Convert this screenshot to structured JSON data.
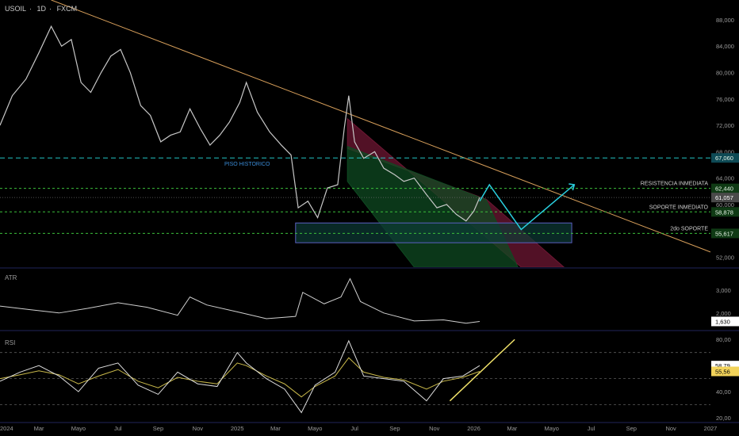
{
  "header": {
    "symbol": "USOIL",
    "timeframe": "1D",
    "exchange": "FXCM"
  },
  "colors": {
    "background": "#000000",
    "price": "#c7c7c7",
    "trendline": "#d9a05b",
    "dashed_level": "#22c3c3",
    "green_level": "#3bbf3b",
    "support_box_fill": "#0d3b36",
    "support_box_border": "#5a5fc0",
    "channel_red": "#6e1733",
    "channel_green": "#0f4a22",
    "projection": "#2ad0e0",
    "rsi_trend": "#f2e36a",
    "rsi_ma": "#c9b94a"
  },
  "chart_data": [
    {
      "type": "line",
      "name": "price",
      "x_ticks": [
        "2024",
        "Mar",
        "Mayo",
        "Jul",
        "Sep",
        "Nov",
        "2025",
        "Mar",
        "Mayo",
        "Jul",
        "Sep",
        "Nov",
        "2026",
        "Mar",
        "Mayo",
        "Jul",
        "Sep",
        "Nov",
        "2027"
      ],
      "x_range": [
        "2024-01",
        "2027-01"
      ],
      "y_ticks": [
        52000,
        56000,
        60000,
        64000,
        68000,
        72000,
        76000,
        80000,
        84000,
        88000
      ],
      "y_tick_labels": [
        "52,000",
        "56,000",
        "60,000",
        "64,000",
        "68,000",
        "72,000",
        "76,000",
        "80,000",
        "84,000",
        "88,000"
      ],
      "ylim": [
        50500,
        91000
      ],
      "grid": false,
      "x": [
        "2024-01-01",
        "2024-01-20",
        "2024-02-10",
        "2024-03-01",
        "2024-03-20",
        "2024-04-05",
        "2024-04-20",
        "2024-05-05",
        "2024-05-20",
        "2024-06-05",
        "2024-06-20",
        "2024-07-05",
        "2024-07-20",
        "2024-08-05",
        "2024-08-20",
        "2024-09-05",
        "2024-09-20",
        "2024-10-05",
        "2024-10-20",
        "2024-11-05",
        "2024-11-20",
        "2024-12-05",
        "2024-12-20",
        "2025-01-05",
        "2025-01-15",
        "2025-02-01",
        "2025-02-20",
        "2025-03-10",
        "2025-03-25",
        "2025-04-05",
        "2025-04-20",
        "2025-05-05",
        "2025-05-20",
        "2025-06-05",
        "2025-06-15",
        "2025-06-22",
        "2025-07-01",
        "2025-07-15",
        "2025-08-01",
        "2025-08-15",
        "2025-09-01",
        "2025-09-15",
        "2025-10-01",
        "2025-10-20",
        "2025-11-05",
        "2025-11-20",
        "2025-12-05",
        "2025-12-20",
        "2026-01-01",
        "2026-01-10"
      ],
      "y": [
        72000,
        76500,
        79000,
        83000,
        87000,
        84000,
        85000,
        78500,
        77000,
        80000,
        82500,
        83500,
        80000,
        75000,
        73500,
        69500,
        70500,
        71000,
        74500,
        71500,
        69000,
        70500,
        72500,
        75500,
        78500,
        74000,
        71000,
        69000,
        67500,
        59500,
        60500,
        58000,
        62500,
        63000,
        71500,
        76500,
        69500,
        67000,
        68000,
        65500,
        64500,
        63500,
        64000,
        61500,
        59500,
        60000,
        58500,
        57500,
        59000,
        61057
      ],
      "last_price_label": "61,057"
    },
    {
      "type": "line",
      "name": "ATR",
      "y_ticks": [
        2000,
        3000
      ],
      "y_tick_labels": [
        "2,000",
        "3,000"
      ],
      "ylim": [
        1300,
        3900
      ],
      "x": [
        "2024-01-01",
        "2024-02-15",
        "2024-04-01",
        "2024-05-15",
        "2024-07-01",
        "2024-08-15",
        "2024-10-01",
        "2024-10-20",
        "2024-11-15",
        "2025-01-01",
        "2025-02-15",
        "2025-04-01",
        "2025-04-12",
        "2025-05-15",
        "2025-06-10",
        "2025-06-24",
        "2025-07-10",
        "2025-08-15",
        "2025-10-01",
        "2025-11-15",
        "2025-12-20",
        "2026-01-10"
      ],
      "y": [
        2300,
        2150,
        2000,
        2200,
        2450,
        2250,
        1900,
        2700,
        2350,
        2050,
        1750,
        1850,
        2900,
        2400,
        2700,
        3500,
        2500,
        2000,
        1650,
        1700,
        1550,
        1630
      ],
      "last_value_label": "1,630"
    },
    {
      "type": "line",
      "name": "RSI",
      "y_ticks": [
        20,
        40,
        60,
        80
      ],
      "y_tick_labels": [
        "20,00",
        "40,00",
        "60,00",
        "80,00"
      ],
      "ylim": [
        17,
        85
      ],
      "levels": [
        70,
        50,
        30
      ],
      "x": [
        "2024-01-01",
        "2024-02-01",
        "2024-03-01",
        "2024-04-01",
        "2024-05-01",
        "2024-06-01",
        "2024-07-01",
        "2024-08-01",
        "2024-09-01",
        "2024-10-01",
        "2024-11-01",
        "2024-12-01",
        "2025-01-01",
        "2025-01-15",
        "2025-02-15",
        "2025-03-15",
        "2025-04-10",
        "2025-05-01",
        "2025-06-01",
        "2025-06-22",
        "2025-07-15",
        "2025-08-15",
        "2025-09-15",
        "2025-10-20",
        "2025-11-15",
        "2025-12-15",
        "2026-01-10"
      ],
      "y": [
        48,
        55,
        60,
        52,
        40,
        58,
        62,
        45,
        38,
        55,
        46,
        44,
        70,
        62,
        50,
        42,
        24,
        45,
        55,
        79,
        52,
        50,
        48,
        33,
        50,
        52,
        60
      ],
      "ma_y": [
        50,
        53,
        56,
        53,
        46,
        52,
        57,
        48,
        43,
        51,
        48,
        46,
        62,
        60,
        52,
        46,
        36,
        44,
        52,
        66,
        55,
        51,
        49,
        42,
        48,
        51,
        55.56
      ],
      "last_value_label": "58,79",
      "ma_value_label": "55,56"
    }
  ],
  "levels": [
    {
      "id": "piso",
      "value": 67060,
      "label": "PISO HISTORICO",
      "value_label": "67,060"
    },
    {
      "id": "resistencia",
      "value": 62440,
      "label": "RESISTENCIA INMEDIATA",
      "value_label": "62,440"
    },
    {
      "id": "soporte",
      "value": 58878,
      "label": "SOPORTE INMEDIATO",
      "value_label": "58,878"
    },
    {
      "id": "soporte2",
      "value": 55617,
      "label": "2do SOPORTE",
      "value_label": "55,617"
    }
  ],
  "support_zone": {
    "x_start": "2025-04-01",
    "x_end": "2026-06-01",
    "y_low": 54200,
    "y_high": 57200
  },
  "downtrend_line": [
    {
      "x": "2024-03-20",
      "y": 91000
    },
    {
      "x": "2027-01-01",
      "y": 52800
    }
  ],
  "channel": {
    "red": [
      {
        "x": "2025-06-20",
        "y": 73000
      },
      {
        "x": "2026-03-15",
        "y": 50500
      },
      {
        "x": "2026-05-20",
        "y": 50500
      },
      {
        "x": "2026-01-20",
        "y": 60800
      },
      {
        "x": "2025-06-20",
        "y": 68500
      }
    ],
    "green": [
      {
        "x": "2025-06-20",
        "y": 68800
      },
      {
        "x": "2026-01-20",
        "y": 60700
      },
      {
        "x": "2026-03-10",
        "y": 50500
      },
      {
        "x": "2025-10-01",
        "y": 50500
      },
      {
        "x": "2025-06-20",
        "y": 63500
      }
    ]
  },
  "projection": [
    {
      "x": "2026-01-10",
      "y": 60500
    },
    {
      "x": "2026-01-25",
      "y": 63000
    },
    {
      "x": "2026-03-15",
      "y": 56200
    },
    {
      "x": "2026-06-05",
      "y": 63000
    }
  ],
  "rsi_trendline": [
    {
      "x": "2025-11-25",
      "y": 33
    },
    {
      "x": "2026-03-05",
      "y": 80
    }
  ]
}
